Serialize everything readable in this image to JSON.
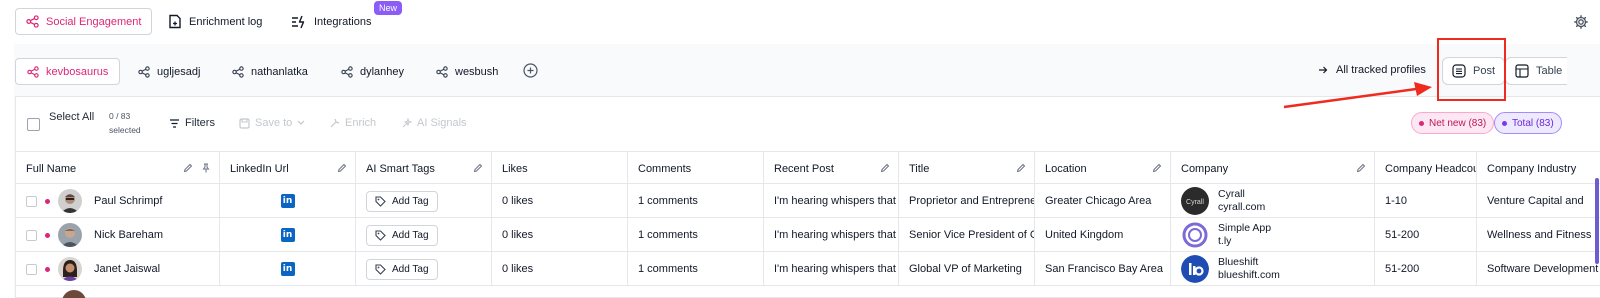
{
  "topnav": {
    "tabs": [
      {
        "label": "Social Engagement",
        "icon": "share-icon",
        "active": true
      },
      {
        "label": "Enrichment log",
        "icon": "document-plus-icon"
      },
      {
        "label": "Integrations",
        "icon": "integrations-icon",
        "badge": "New"
      }
    ],
    "settings_icon": "gear-icon"
  },
  "profiles": {
    "items": [
      {
        "label": "kevbosaurus",
        "active": true
      },
      {
        "label": "ugljesadj"
      },
      {
        "label": "nathanlatka"
      },
      {
        "label": "dylanhey"
      },
      {
        "label": "wesbush"
      }
    ],
    "all_tracked": "All tracked profiles",
    "view_post": "Post",
    "view_table": "Table"
  },
  "toolbar": {
    "select_all": "Select All",
    "count": "0 / 83",
    "selected": "selected",
    "filters": "Filters",
    "save_to": "Save to",
    "enrich": "Enrich",
    "ai_signals": "AI Signals",
    "net_new": "Net new (83)",
    "total": "Total (83)"
  },
  "columns": [
    "Full Name",
    "LinkedIn Url",
    "AI Smart Tags",
    "Likes",
    "Comments",
    "Recent Post",
    "Title",
    "Location",
    "Company",
    "Company Headcount",
    "Company Industry"
  ],
  "rows": [
    {
      "name": "Paul Schrimpf",
      "tag": "Add Tag",
      "likes": "0 likes",
      "comments": "1 comments",
      "post": "I'm hearing whispers that AI",
      "title": "Proprietor and Entrepreneur",
      "location": "Greater Chicago Area",
      "company": "Cyrall",
      "domain": "cyrall.com",
      "headcount": "1-10",
      "industry": "Venture Capital and"
    },
    {
      "name": "Nick Bareham",
      "tag": "Add Tag",
      "likes": "0 likes",
      "comments": "1 comments",
      "post": "I'm hearing whispers that AI",
      "title": "Senior Vice President of Global",
      "location": "United Kingdom",
      "company": "Simple App",
      "domain": "t.ly",
      "headcount": "51-200",
      "industry": "Wellness and Fitness"
    },
    {
      "name": "Janet Jaiswal",
      "tag": "Add Tag",
      "likes": "0 likes",
      "comments": "1 comments",
      "post": "I'm hearing whispers that AI",
      "title": "Global VP of Marketing",
      "location": "San Francisco Bay Area",
      "company": "Blueshift",
      "domain": "blueshift.com",
      "headcount": "51-200",
      "industry": "Software Development"
    }
  ],
  "colors": {
    "accent_pink": "#db2777",
    "accent_purple": "#8b5cf6",
    "annotation_red": "#ef2a1f",
    "linkedin": "#0a66c2"
  }
}
